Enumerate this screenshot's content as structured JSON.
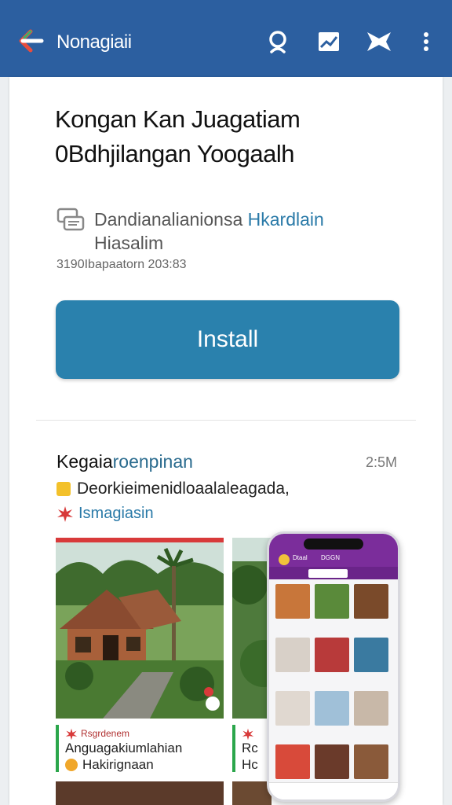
{
  "app_bar": {
    "title": "Nonagiaii",
    "bg_color": "#2c5fa0",
    "icons": [
      "back-arrow-icon",
      "search-icon",
      "trending-icon",
      "bookmark-icon",
      "more-vert-icon"
    ]
  },
  "app": {
    "title_line1": "Kongan Kan Juagatiam",
    "title_line2a": "0Bdhjilangan",
    "title_line2b": "Yoogaalh",
    "developer": "Dandianalianionsa",
    "developer_link": "Hkardlain",
    "developer_line2": "Hiasalim",
    "meta": "3190Ibapaatorn 203:83"
  },
  "install_button": {
    "label": "Install",
    "color": "#2a81ad"
  },
  "section": {
    "title": "Kegaia",
    "title_accent": "roenpinan",
    "time": "2:5M",
    "line1": "Deorkieimenidloaalaleagada,",
    "line2": "Ismagiasin"
  },
  "screenshots": [
    {
      "caption_top": "Rsgrdenem",
      "caption_line1": "Anguagakiumlahian",
      "caption_line2": "Hakirignaan"
    },
    {
      "caption_top": "",
      "caption_line1": "Rc",
      "caption_line2": "Hc"
    }
  ],
  "phone_mock": {
    "app_name": "Dtaal",
    "header": "DGGN",
    "accent_color": "#7b2d9b"
  }
}
